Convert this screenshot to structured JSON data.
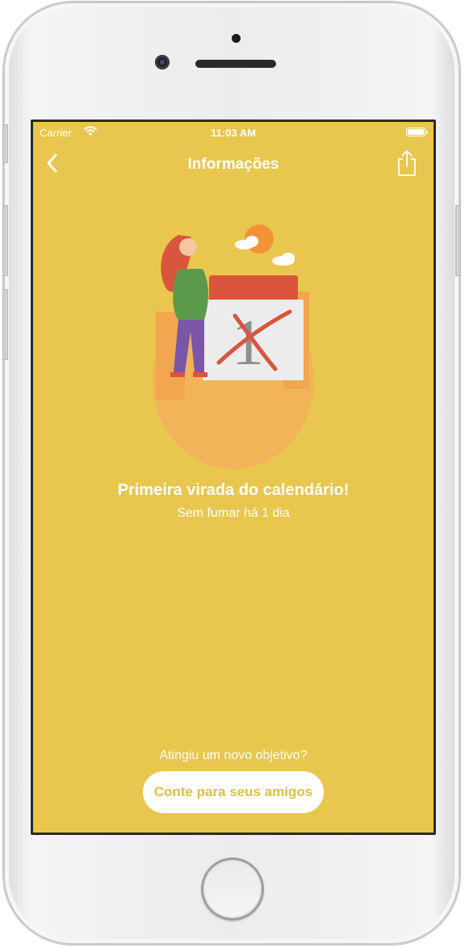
{
  "status_bar": {
    "carrier": "Carrier",
    "time": "11:03 AM"
  },
  "nav": {
    "title": "Informações",
    "back_icon": "chevron-left-icon",
    "share_icon": "share-icon"
  },
  "milestone": {
    "title": "Primeira virada do calendário!",
    "subtitle": "Sem fumar há 1 dia",
    "calendar_number": "1"
  },
  "footer": {
    "prompt": "Atingiu um novo objetivo?",
    "button_label": "Conte para seus amigos"
  },
  "colors": {
    "background": "#e9c64e",
    "accent_text": "#e2bd45",
    "calendar_header": "#d9553d",
    "cross": "#d9553d"
  }
}
